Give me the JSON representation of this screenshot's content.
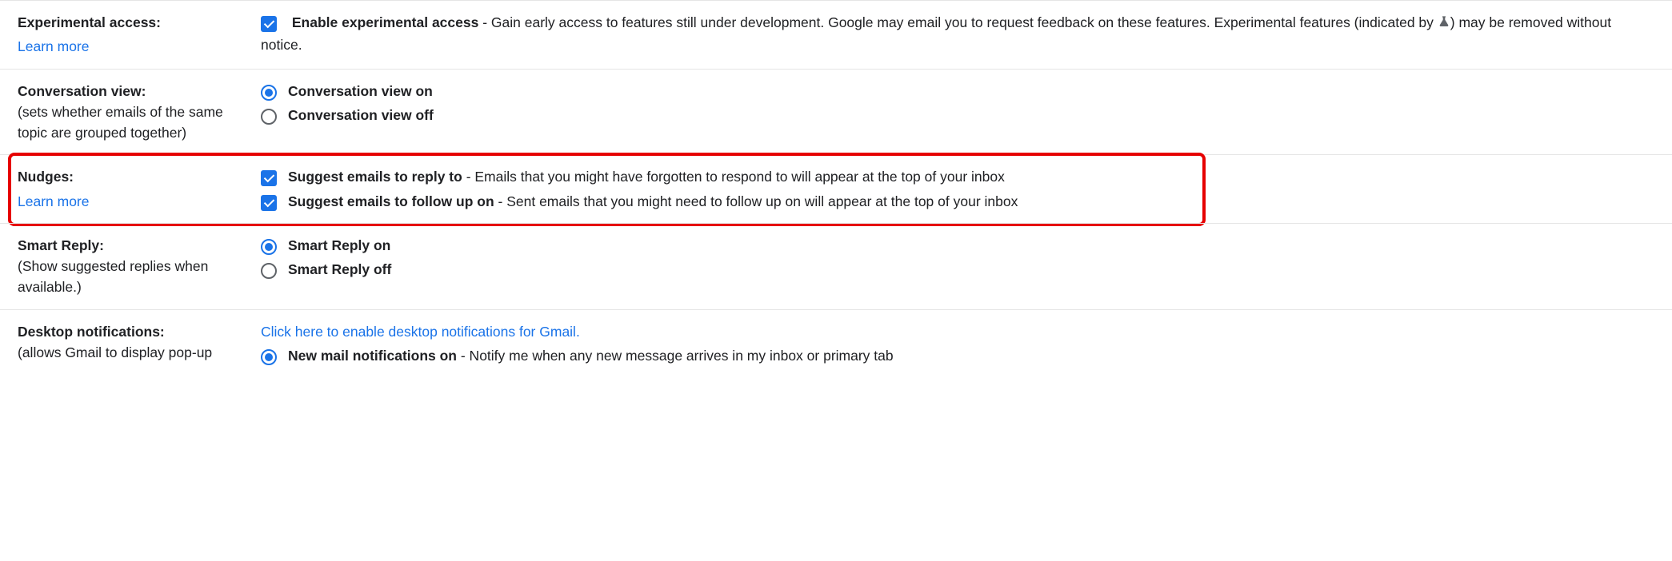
{
  "experimental": {
    "title": "Experimental access:",
    "learn_more": "Learn more",
    "checkbox_label": "Enable experimental access",
    "desc_before_icon": " - Gain early access to features still under development. Google may email you to request feedback on these features. Experimental features (indicated by ",
    "desc_after_icon": ") may be removed without notice."
  },
  "conversation": {
    "title": "Conversation view:",
    "desc": "(sets whether emails of the same topic are grouped together)",
    "on": "Conversation view on",
    "off": "Conversation view off"
  },
  "nudges": {
    "title": "Nudges:",
    "learn_more": "Learn more",
    "reply_label": "Suggest emails to reply to",
    "reply_desc": " - Emails that you might have forgotten to respond to will appear at the top of your inbox",
    "follow_label": "Suggest emails to follow up on",
    "follow_desc": " - Sent emails that you might need to follow up on will appear at the top of your inbox"
  },
  "smart_reply": {
    "title": "Smart Reply:",
    "desc": "(Show suggested replies when available.)",
    "on": "Smart Reply on",
    "off": "Smart Reply off"
  },
  "desktop": {
    "title": "Desktop notifications:",
    "desc": "(allows Gmail to display pop-up",
    "enable_link": "Click here to enable desktop notifications for Gmail.",
    "new_mail_label": "New mail notifications on",
    "new_mail_desc": " - Notify me when any new message arrives in my inbox or primary tab"
  }
}
